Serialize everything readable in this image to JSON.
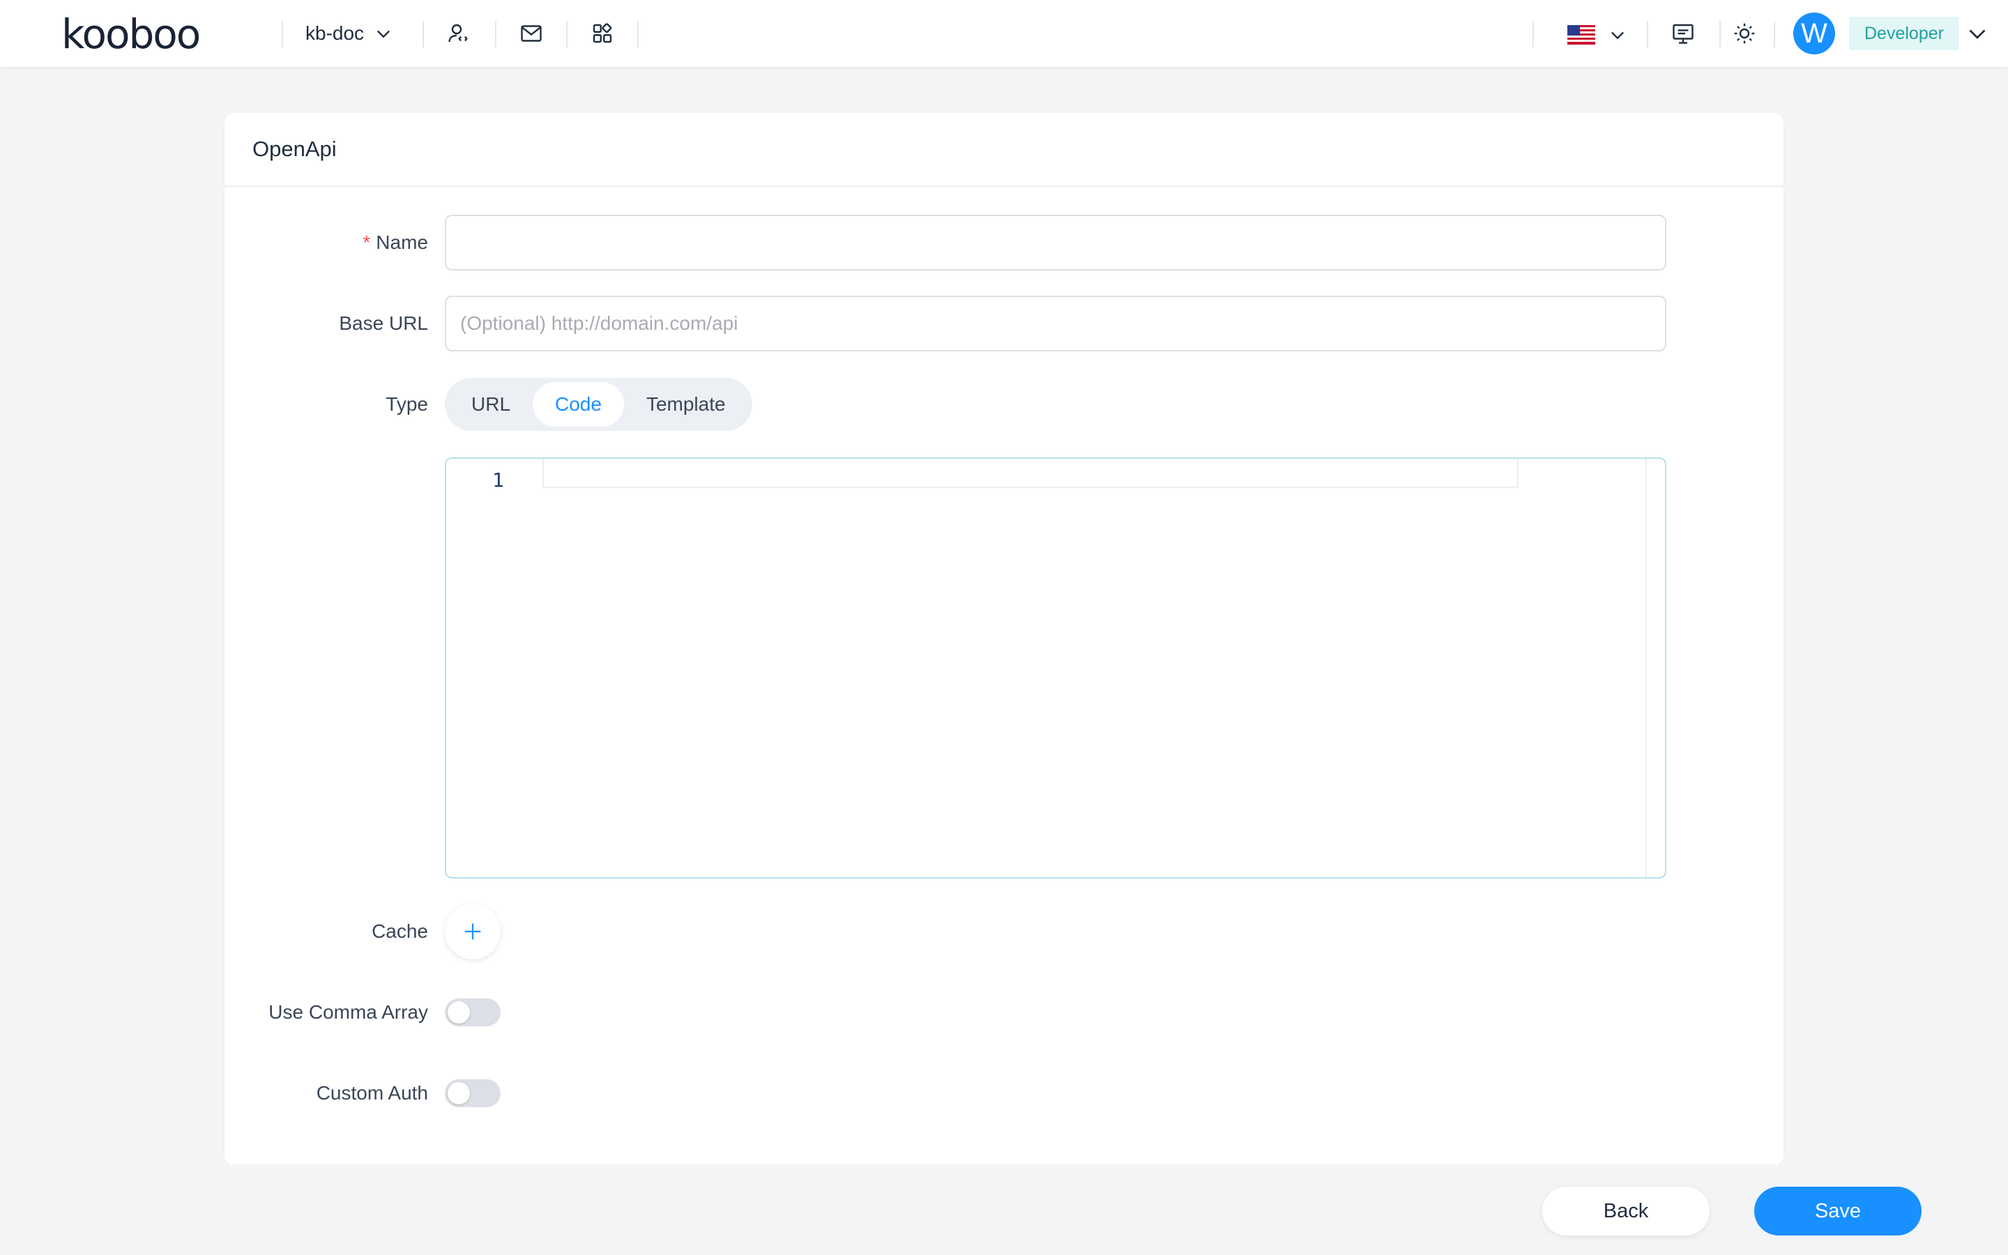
{
  "header": {
    "logo_text": "kooboo",
    "site_name": "kb-doc",
    "icons": [
      "user-code-icon",
      "mail-icon",
      "apps-icon",
      "language-flag-icon",
      "monitor-icon",
      "sun-icon",
      "chevron-down-icon"
    ],
    "avatar_letter": "W",
    "role": "Developer"
  },
  "card": {
    "title": "OpenApi"
  },
  "form": {
    "name": {
      "label": "Name",
      "required_mark": "*",
      "value": "",
      "placeholder": ""
    },
    "base_url": {
      "label": "Base URL",
      "value": "",
      "placeholder": "(Optional) http://domain.com/api"
    },
    "type": {
      "label": "Type",
      "options": [
        "URL",
        "Code",
        "Template"
      ],
      "selected": "Code"
    },
    "editor": {
      "line_number": "1",
      "content": ""
    },
    "cache": {
      "label": "Cache"
    },
    "use_comma_array": {
      "label": "Use Comma Array",
      "enabled": false
    },
    "custom_auth": {
      "label": "Custom Auth",
      "enabled": false
    }
  },
  "footer": {
    "back_label": "Back",
    "save_label": "Save"
  },
  "colors": {
    "accent": "#1890ff",
    "required": "#f5504f",
    "role_badge_bg": "#e3f6f6",
    "role_badge_text": "#20a0a0"
  }
}
